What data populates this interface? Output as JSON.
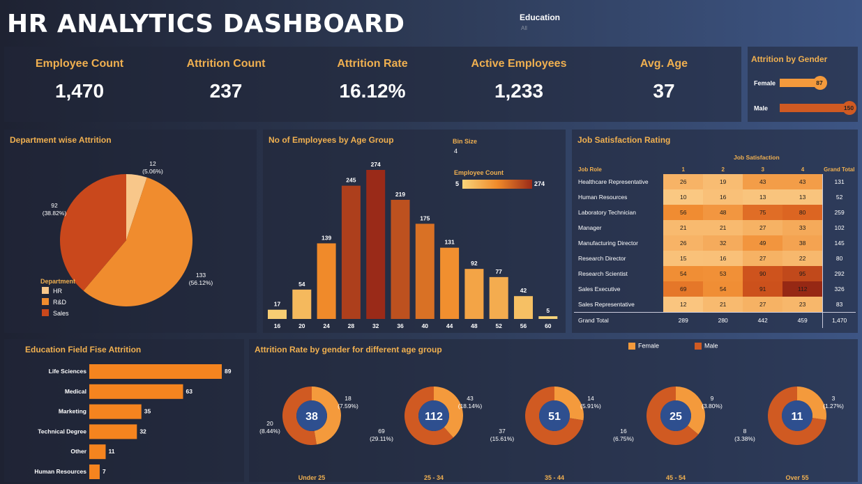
{
  "title": "HR ANALYTICS DASHBOARD",
  "filter": {
    "label": "Education",
    "value": "All"
  },
  "kpis": [
    {
      "label": "Employee Count",
      "value": "1,470"
    },
    {
      "label": "Attrition Count",
      "value": "237"
    },
    {
      "label": "Attrition Rate",
      "value": "16.12%"
    },
    {
      "label": "Active Employees",
      "value": "1,233"
    },
    {
      "label": "Avg. Age",
      "value": "37"
    }
  ],
  "gender_panel": {
    "title": "Attrition by Gender"
  },
  "dept_panel": {
    "title": "Department wise Attrition",
    "legend_title": "Department"
  },
  "age_panel": {
    "title": "No of Employees by Age Group",
    "bin_label": "Bin Size",
    "bin_value": "4",
    "scale_label": "Employee Count",
    "scale_min": "5",
    "scale_max": "274"
  },
  "job_panel": {
    "title": "Job Satisfaction Rating",
    "col_group": "Job Satisfaction",
    "row_header": "Job Role",
    "total_header": "Grand Total",
    "total_row_label": "Grand Total"
  },
  "edu_panel": {
    "title": "Education Field Fise Attrition"
  },
  "donut_panel": {
    "title": "Attrition Rate by gender for different age group",
    "legend": [
      "Female",
      "Male"
    ]
  },
  "colors": {
    "female": "#f49a3c",
    "male": "#d05a22",
    "hr": "#f8c78a",
    "rd": "#f08c2e",
    "sales": "#c9481c",
    "orange_bar": "#f5841f"
  },
  "chart_data": [
    {
      "type": "bar",
      "id": "gender",
      "orientation": "horizontal",
      "categories": [
        "Female",
        "Male"
      ],
      "values": [
        87,
        150
      ]
    },
    {
      "type": "pie",
      "id": "department",
      "labels": [
        "HR",
        "R&D",
        "Sales"
      ],
      "values": [
        12,
        133,
        92
      ],
      "percent_labels": [
        "(5.06%)",
        "(56.12%)",
        "(38.82%)"
      ]
    },
    {
      "type": "bar",
      "id": "age_group",
      "categories": [
        "16",
        "20",
        "24",
        "28",
        "32",
        "36",
        "40",
        "44",
        "48",
        "52",
        "56",
        "60"
      ],
      "values": [
        17,
        54,
        139,
        245,
        274,
        219,
        175,
        131,
        92,
        77,
        42,
        5
      ]
    },
    {
      "type": "heatmap",
      "id": "job_satisfaction",
      "columns": [
        "1",
        "2",
        "3",
        "4"
      ],
      "rows": [
        "Healthcare Representative",
        "Human Resources",
        "Laboratory Technician",
        "Manager",
        "Manufacturing Director",
        "Research Director",
        "Research Scientist",
        "Sales Executive",
        "Sales Representative"
      ],
      "values": [
        [
          26,
          19,
          43,
          43
        ],
        [
          10,
          16,
          13,
          13
        ],
        [
          56,
          48,
          75,
          80
        ],
        [
          21,
          21,
          27,
          33
        ],
        [
          26,
          32,
          49,
          38
        ],
        [
          15,
          16,
          27,
          22
        ],
        [
          54,
          53,
          90,
          95
        ],
        [
          69,
          54,
          91,
          112
        ],
        [
          12,
          21,
          27,
          23
        ]
      ],
      "row_totals": [
        131,
        52,
        259,
        102,
        145,
        80,
        292,
        326,
        83
      ],
      "col_totals": [
        289,
        280,
        442,
        459
      ],
      "grand_total": "1,470"
    },
    {
      "type": "bar",
      "id": "education",
      "orientation": "horizontal",
      "categories": [
        "Life Sciences",
        "Medical",
        "Marketing",
        "Technical Degree",
        "Other",
        "Human Resources"
      ],
      "values": [
        89,
        63,
        35,
        32,
        11,
        7
      ]
    },
    {
      "type": "pie",
      "id": "gender_age_donuts",
      "groups": [
        {
          "name": "Under 25",
          "total": 38,
          "female": 18,
          "female_pct": "(7.59%)",
          "male": 20,
          "male_pct": "(8.44%)"
        },
        {
          "name": "25 - 34",
          "total": 112,
          "female": 43,
          "female_pct": "(18.14%)",
          "male": 69,
          "male_pct": "(29.11%)"
        },
        {
          "name": "35 - 44",
          "total": 51,
          "female": 14,
          "female_pct": "(5.91%)",
          "male": 37,
          "male_pct": "(15.61%)"
        },
        {
          "name": "45 - 54",
          "total": 25,
          "female": 9,
          "female_pct": "(3.80%)",
          "male": 16,
          "male_pct": "(6.75%)"
        },
        {
          "name": "Over 55",
          "total": 11,
          "female": 3,
          "female_pct": "(1.27%)",
          "male": 8,
          "male_pct": "(3.38%)"
        }
      ]
    }
  ]
}
